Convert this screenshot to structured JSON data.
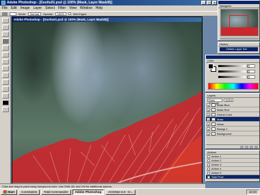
{
  "app": {
    "title": "Adobe Photoshop - [Dust\\u01.psd @ 100% (Mask, Layer Mask/8)]"
  },
  "menu": [
    "File",
    "Edit",
    "Image",
    "Layer",
    "Select",
    "Filter",
    "View",
    "Window",
    "Help"
  ],
  "options_bar": {
    "mode_label": "Mode:",
    "mode_value": "Normal",
    "opacity_label": "Opacity:",
    "opacity_value": "100%",
    "wet_edges_label": "Wet Edges"
  },
  "document": {
    "zoom": "100%",
    "status_text": "Doc: 1.87M/4.61M"
  },
  "navigator": {
    "tab": "Navigator"
  },
  "history": {
    "tab": "History",
    "items": [
      "Delete Layer Set"
    ]
  },
  "color": {
    "tab": "Color",
    "values": [
      "0",
      "0",
      "0"
    ]
  },
  "layers": {
    "tab": "Layers",
    "blend_mode": "Pass Through",
    "opacity": "100%",
    "rows": [
      {
        "name": "Mask Blue",
        "active": false
      },
      {
        "name": "Mask Red",
        "active": false
      },
      {
        "name": "Global Color",
        "active": false
      },
      {
        "name": "Mask",
        "active": true
      },
      {
        "name": "Noise",
        "active": false
      },
      {
        "name": "Backgr 1",
        "active": false
      },
      {
        "name": "Background",
        "active": false
      }
    ]
  },
  "actions": {
    "tab": "Actions",
    "rows": [
      {
        "name": "Action 1",
        "active": false
      },
      {
        "name": "Action 2",
        "active": false
      },
      {
        "name": "Action 3",
        "active": false
      },
      {
        "name": "Action 4",
        "active": false
      },
      {
        "name": "Action 5",
        "active": false
      },
      {
        "name": "Start Post",
        "active": true
      }
    ]
  },
  "status_bar": {
    "text": "Click and drag to paint using foreground color. Use Shift, Alt, and Ctrl for additional options."
  },
  "taskbar": {
    "start": "Start",
    "tasks": [
      "Constraints",
      "Total Commander",
      "Adobe Photoshop",
      "ACDSee 6.0 - D..."
    ],
    "active_task": 2,
    "clock": "18:40"
  },
  "colors": {
    "accent": "#0a246a",
    "mask_red": "#c8282e"
  }
}
